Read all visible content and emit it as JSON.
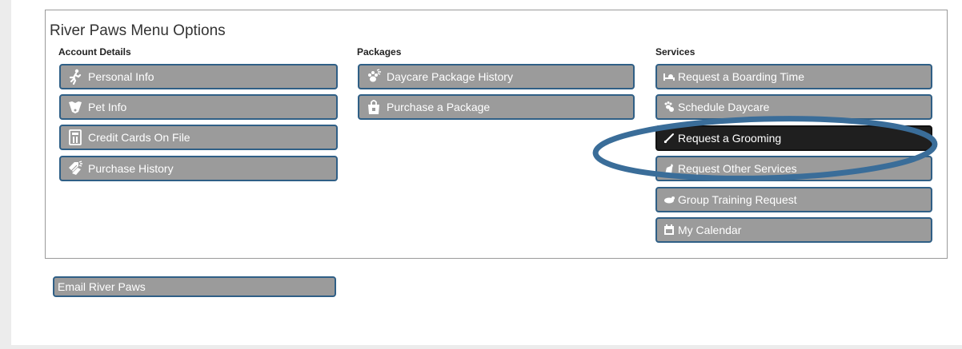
{
  "menu": {
    "title": "River Paws Menu Options",
    "columns": {
      "account": {
        "heading": "Account Details",
        "items": [
          {
            "label": "Personal Info",
            "icon": "running-person-icon"
          },
          {
            "label": "Pet Info",
            "icon": "dog-face-icon"
          },
          {
            "label": "Credit Cards On File",
            "icon": "card-reader-icon"
          },
          {
            "label": "Purchase History",
            "icon": "price-tags-icon"
          }
        ]
      },
      "packages": {
        "heading": "Packages",
        "items": [
          {
            "label": "Daycare Package History",
            "icon": "paw-sparkle-icon"
          },
          {
            "label": "Purchase a Package",
            "icon": "shopping-bag-icon"
          }
        ]
      },
      "services": {
        "heading": "Services",
        "items": [
          {
            "label": "Request a Boarding Time",
            "icon": "bed-icon"
          },
          {
            "label": "Schedule Daycare",
            "icon": "paws-icon"
          },
          {
            "label": "Request a Grooming",
            "icon": "scissors-icon",
            "active": true
          },
          {
            "label": "Request Other Services",
            "icon": "dog-sitting-icon"
          },
          {
            "label": "Group Training Request",
            "icon": "dog-icon"
          },
          {
            "label": "My Calendar",
            "icon": "calendar-icon"
          }
        ]
      }
    }
  },
  "email_button": {
    "label": "Email River Paws"
  },
  "colors": {
    "button_bg": "#9b9b9b",
    "button_border": "#2f5f86",
    "active_bg": "#1f1f1f",
    "annotation_ellipse": "#3a6d99"
  }
}
